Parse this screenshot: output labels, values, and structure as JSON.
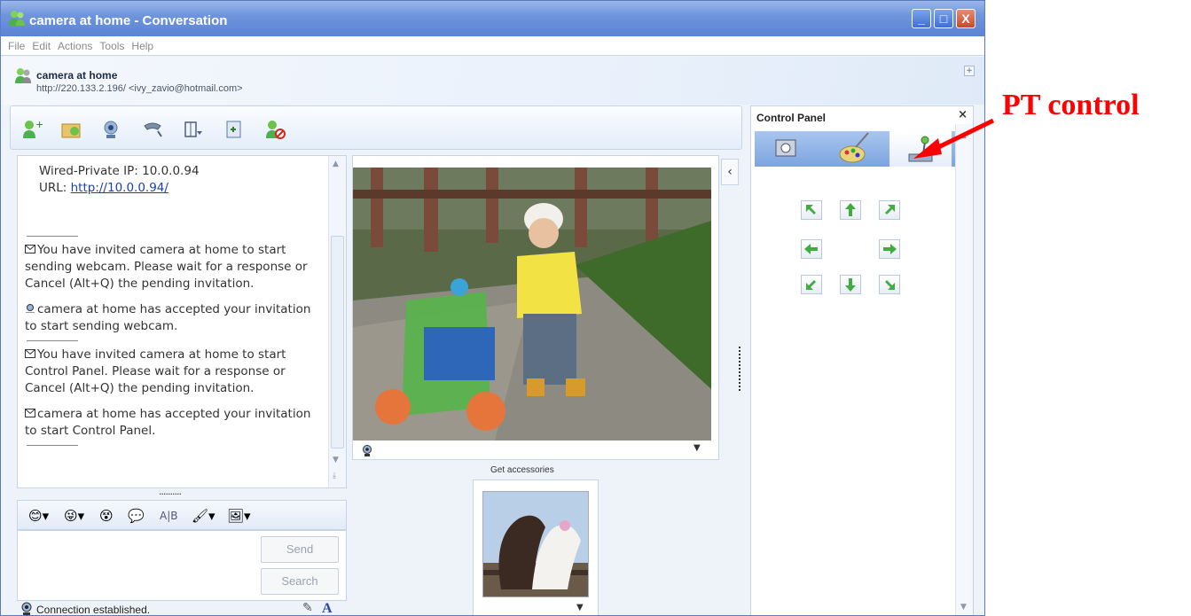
{
  "window": {
    "title": "camera at home - Conversation",
    "buttons": {
      "minimize": "_",
      "maximize": "□",
      "close": "X"
    }
  },
  "menu": [
    "File",
    "Edit",
    "Actions",
    "Tools",
    "Help"
  ],
  "contact": {
    "name": "camera at home",
    "address": "http://220.133.2.196/ <ivy_zavio@hotmail.com>"
  },
  "toolbar": {
    "icons": [
      "invite-contact-icon",
      "share-folder-icon",
      "webcam-icon",
      "call-icon",
      "activities-icon",
      "games-icon",
      "block-icon"
    ]
  },
  "log": {
    "ip_line": "Wired-Private IP: 10.0.0.94",
    "url_label": "URL: ",
    "url": "http://10.0.0.94/",
    "messages": [
      "You have invited camera at home to start sending webcam. Please wait for a response or Cancel (Alt+Q) the pending invitation.",
      "camera at home has accepted your invitation to start sending webcam.",
      "You have invited camera at home to start Control Panel. Please wait for a response or Cancel (Alt+Q) the pending invitation.",
      "camera at home has accepted your invitation to start Control Panel."
    ]
  },
  "compose": {
    "send_label": "Send",
    "search_label": "Search"
  },
  "status": {
    "text": "Connection established."
  },
  "accessories": {
    "label": "Get accessories"
  },
  "control_panel": {
    "title": "Control Panel",
    "close": "×"
  },
  "annotation": {
    "text": "PT control",
    "color": "#ff0000"
  },
  "colors": {
    "titlebar": "#5a83d3",
    "ptz_arrow": "#3fae3f",
    "link": "#1b3fb0"
  }
}
